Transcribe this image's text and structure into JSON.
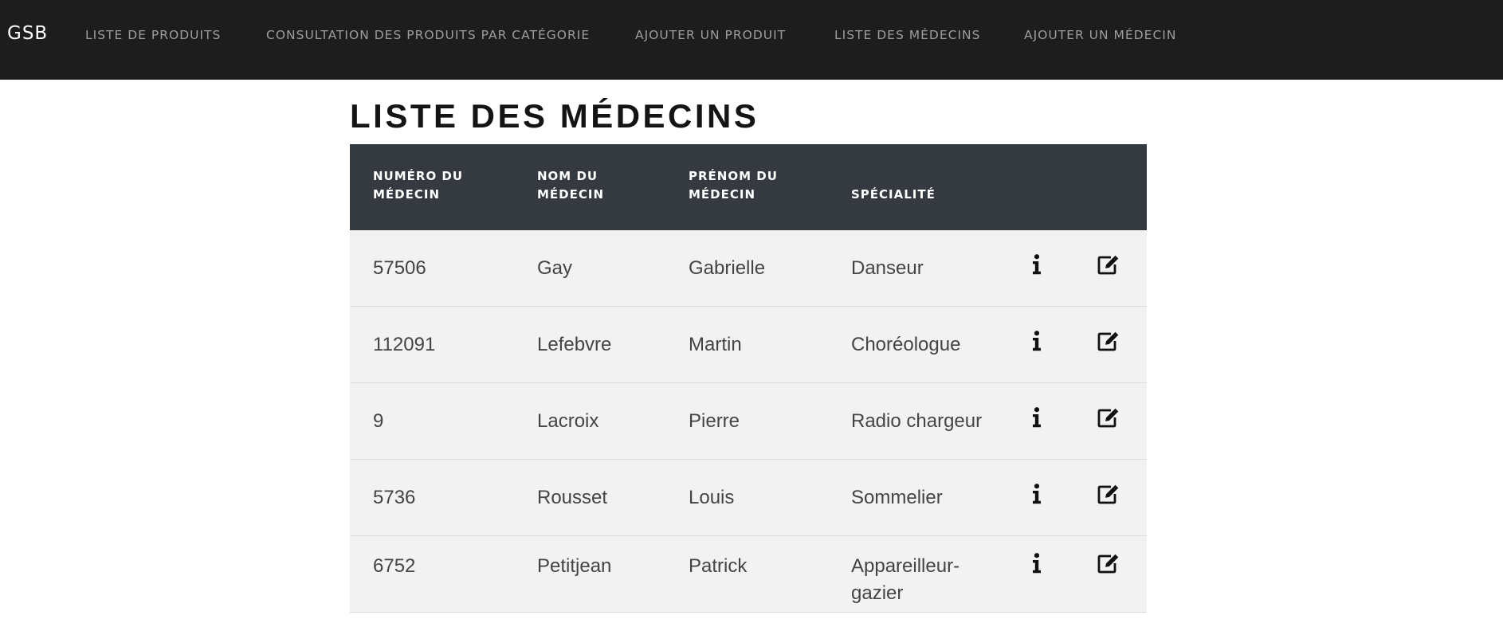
{
  "navbar": {
    "brand": "GSB",
    "links": [
      {
        "label": "LISTE DE PRODUITS"
      },
      {
        "label": "CONSULTATION DES PRODUITS PAR CATÉGORIE"
      },
      {
        "label": "AJOUTER UN PRODUIT"
      },
      {
        "label": "LISTE DES MÉDECINS"
      },
      {
        "label": "AJOUTER UN MÉDECIN"
      }
    ]
  },
  "page": {
    "title": "LISTE DES MÉDECINS"
  },
  "table": {
    "headers": {
      "numero": [
        "NUMÉRO DU",
        "MÉDECIN"
      ],
      "nom": [
        "NOM DU",
        "MÉDECIN"
      ],
      "prenom": [
        "PRÉNOM DU",
        "MÉDECIN"
      ],
      "specialite": [
        "SPÉCIALITÉ"
      ]
    },
    "rows": [
      {
        "numero": "57506",
        "nom": "Gay",
        "prenom": "Gabrielle",
        "specialite": "Danseur"
      },
      {
        "numero": "112091",
        "nom": "Lefebvre",
        "prenom": "Martin",
        "specialite": "Choréologue"
      },
      {
        "numero": "9",
        "nom": "Lacroix",
        "prenom": "Pierre",
        "specialite": "Radio chargeur"
      },
      {
        "numero": "5736",
        "nom": "Rousset",
        "prenom": "Louis",
        "specialite": "Sommelier"
      },
      {
        "numero": "6752",
        "nom": "Petitjean",
        "prenom": "Patrick",
        "specialite": "Appareilleur-gazier"
      }
    ],
    "row_actions": [
      {
        "icon": "info-icon"
      },
      {
        "icon": "edit-icon"
      }
    ]
  },
  "colors": {
    "navbar_bg": "#1d1d1d",
    "nav_link": "#9d9d9d",
    "table_header_bg": "#343a40",
    "row_bg": "#f2f2f2",
    "text": "#444444"
  }
}
